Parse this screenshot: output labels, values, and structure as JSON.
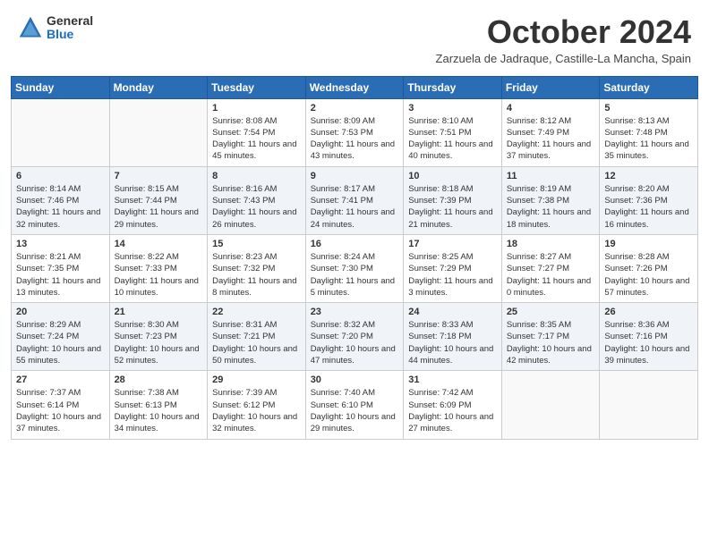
{
  "logo": {
    "general": "General",
    "blue": "Blue"
  },
  "title": "October 2024",
  "location": "Zarzuela de Jadraque, Castille-La Mancha, Spain",
  "weekdays": [
    "Sunday",
    "Monday",
    "Tuesday",
    "Wednesday",
    "Thursday",
    "Friday",
    "Saturday"
  ],
  "weeks": [
    [
      {
        "day": "",
        "info": ""
      },
      {
        "day": "",
        "info": ""
      },
      {
        "day": "1",
        "info": "Sunrise: 8:08 AM\nSunset: 7:54 PM\nDaylight: 11 hours and 45 minutes."
      },
      {
        "day": "2",
        "info": "Sunrise: 8:09 AM\nSunset: 7:53 PM\nDaylight: 11 hours and 43 minutes."
      },
      {
        "day": "3",
        "info": "Sunrise: 8:10 AM\nSunset: 7:51 PM\nDaylight: 11 hours and 40 minutes."
      },
      {
        "day": "4",
        "info": "Sunrise: 8:12 AM\nSunset: 7:49 PM\nDaylight: 11 hours and 37 minutes."
      },
      {
        "day": "5",
        "info": "Sunrise: 8:13 AM\nSunset: 7:48 PM\nDaylight: 11 hours and 35 minutes."
      }
    ],
    [
      {
        "day": "6",
        "info": "Sunrise: 8:14 AM\nSunset: 7:46 PM\nDaylight: 11 hours and 32 minutes."
      },
      {
        "day": "7",
        "info": "Sunrise: 8:15 AM\nSunset: 7:44 PM\nDaylight: 11 hours and 29 minutes."
      },
      {
        "day": "8",
        "info": "Sunrise: 8:16 AM\nSunset: 7:43 PM\nDaylight: 11 hours and 26 minutes."
      },
      {
        "day": "9",
        "info": "Sunrise: 8:17 AM\nSunset: 7:41 PM\nDaylight: 11 hours and 24 minutes."
      },
      {
        "day": "10",
        "info": "Sunrise: 8:18 AM\nSunset: 7:39 PM\nDaylight: 11 hours and 21 minutes."
      },
      {
        "day": "11",
        "info": "Sunrise: 8:19 AM\nSunset: 7:38 PM\nDaylight: 11 hours and 18 minutes."
      },
      {
        "day": "12",
        "info": "Sunrise: 8:20 AM\nSunset: 7:36 PM\nDaylight: 11 hours and 16 minutes."
      }
    ],
    [
      {
        "day": "13",
        "info": "Sunrise: 8:21 AM\nSunset: 7:35 PM\nDaylight: 11 hours and 13 minutes."
      },
      {
        "day": "14",
        "info": "Sunrise: 8:22 AM\nSunset: 7:33 PM\nDaylight: 11 hours and 10 minutes."
      },
      {
        "day": "15",
        "info": "Sunrise: 8:23 AM\nSunset: 7:32 PM\nDaylight: 11 hours and 8 minutes."
      },
      {
        "day": "16",
        "info": "Sunrise: 8:24 AM\nSunset: 7:30 PM\nDaylight: 11 hours and 5 minutes."
      },
      {
        "day": "17",
        "info": "Sunrise: 8:25 AM\nSunset: 7:29 PM\nDaylight: 11 hours and 3 minutes."
      },
      {
        "day": "18",
        "info": "Sunrise: 8:27 AM\nSunset: 7:27 PM\nDaylight: 11 hours and 0 minutes."
      },
      {
        "day": "19",
        "info": "Sunrise: 8:28 AM\nSunset: 7:26 PM\nDaylight: 10 hours and 57 minutes."
      }
    ],
    [
      {
        "day": "20",
        "info": "Sunrise: 8:29 AM\nSunset: 7:24 PM\nDaylight: 10 hours and 55 minutes."
      },
      {
        "day": "21",
        "info": "Sunrise: 8:30 AM\nSunset: 7:23 PM\nDaylight: 10 hours and 52 minutes."
      },
      {
        "day": "22",
        "info": "Sunrise: 8:31 AM\nSunset: 7:21 PM\nDaylight: 10 hours and 50 minutes."
      },
      {
        "day": "23",
        "info": "Sunrise: 8:32 AM\nSunset: 7:20 PM\nDaylight: 10 hours and 47 minutes."
      },
      {
        "day": "24",
        "info": "Sunrise: 8:33 AM\nSunset: 7:18 PM\nDaylight: 10 hours and 44 minutes."
      },
      {
        "day": "25",
        "info": "Sunrise: 8:35 AM\nSunset: 7:17 PM\nDaylight: 10 hours and 42 minutes."
      },
      {
        "day": "26",
        "info": "Sunrise: 8:36 AM\nSunset: 7:16 PM\nDaylight: 10 hours and 39 minutes."
      }
    ],
    [
      {
        "day": "27",
        "info": "Sunrise: 7:37 AM\nSunset: 6:14 PM\nDaylight: 10 hours and 37 minutes."
      },
      {
        "day": "28",
        "info": "Sunrise: 7:38 AM\nSunset: 6:13 PM\nDaylight: 10 hours and 34 minutes."
      },
      {
        "day": "29",
        "info": "Sunrise: 7:39 AM\nSunset: 6:12 PM\nDaylight: 10 hours and 32 minutes."
      },
      {
        "day": "30",
        "info": "Sunrise: 7:40 AM\nSunset: 6:10 PM\nDaylight: 10 hours and 29 minutes."
      },
      {
        "day": "31",
        "info": "Sunrise: 7:42 AM\nSunset: 6:09 PM\nDaylight: 10 hours and 27 minutes."
      },
      {
        "day": "",
        "info": ""
      },
      {
        "day": "",
        "info": ""
      }
    ]
  ]
}
